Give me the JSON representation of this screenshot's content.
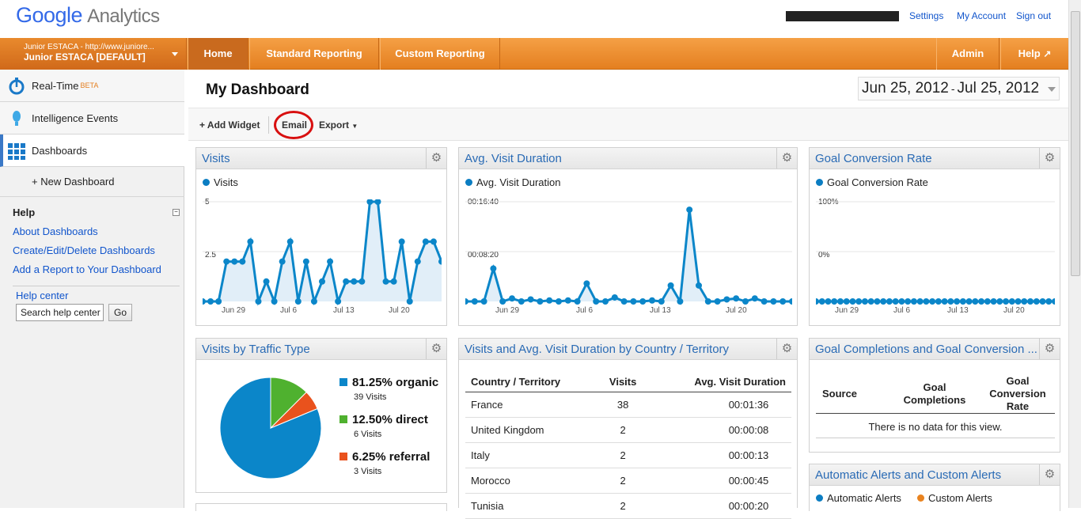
{
  "app": {
    "brand_google": "Google",
    "brand_analytics": "Analytics"
  },
  "toplinks": {
    "settings": "Settings",
    "account": "My Account",
    "signout": "Sign out"
  },
  "account": {
    "line1": "Junior ESTACA - http://www.juniore...",
    "line2": "Junior ESTACA [DEFAULT]"
  },
  "nav": {
    "home": "Home",
    "standard": "Standard Reporting",
    "custom": "Custom Reporting",
    "admin": "Admin",
    "help": "Help"
  },
  "sidebar": {
    "items": [
      {
        "label": "Real-Time",
        "badge": "BETA"
      },
      {
        "label": "Intelligence Events"
      },
      {
        "label": "Dashboards"
      }
    ],
    "new_dashboard": "+ New Dashboard",
    "help_title": "Help",
    "help_links": [
      "About Dashboards",
      "Create/Edit/Delete Dashboards",
      "Add a Report to Your Dashboard"
    ],
    "help_center": "Help center",
    "search_value": "Search help center",
    "go": "Go"
  },
  "dashboard": {
    "title": "My Dashboard",
    "date_start": "Jun 25, 2012",
    "date_sep": "-",
    "date_end": "Jul 25, 2012",
    "toolbar": {
      "add_widget": "+ Add Widget",
      "email": "Email",
      "export": "Export"
    }
  },
  "widgets": {
    "visits": {
      "title": "Visits",
      "legend": "Visits",
      "y_top": "5",
      "y_mid": "2.5"
    },
    "duration": {
      "title": "Avg. Visit Duration",
      "legend": "Avg. Visit Duration",
      "y_top": "00:16:40",
      "y_mid": "00:08:20"
    },
    "goal": {
      "title": "Goal Conversion Rate",
      "legend": "Goal Conversion Rate",
      "y_top": "100%",
      "y_bottom": "0%"
    },
    "x_ticks": [
      "Jun 29",
      "Jul 6",
      "Jul 13",
      "Jul 20"
    ],
    "traffic": {
      "title": "Visits by Traffic Type",
      "slices": [
        {
          "pct": "81.25% organic",
          "sub": "39 Visits",
          "color": "#0b86c9"
        },
        {
          "pct": "12.50% direct",
          "sub": "6 Visits",
          "color": "#4fb12f"
        },
        {
          "pct": "6.25% referral",
          "sub": "3 Visits",
          "color": "#e9521d"
        }
      ]
    },
    "country": {
      "title": "Visits and Avg. Visit Duration by Country / Territory",
      "headers": [
        "Country / Territory",
        "Visits",
        "Avg. Visit Duration"
      ],
      "rows": [
        [
          "France",
          "38",
          "00:01:36"
        ],
        [
          "United Kingdom",
          "2",
          "00:00:08"
        ],
        [
          "Italy",
          "2",
          "00:00:13"
        ],
        [
          "Morocco",
          "2",
          "00:00:45"
        ],
        [
          "Tunisia",
          "2",
          "00:00:20"
        ]
      ]
    },
    "goalcomp": {
      "title": "Goal Completions and Goal Conversion ...",
      "headers": [
        "Source",
        "Goal Completions",
        "Goal Conversion Rate"
      ],
      "empty": "There is no data for this view."
    },
    "alerts": {
      "title": "Automatic Alerts and Custom Alerts",
      "legend1": "Automatic Alerts",
      "legend2": "Custom Alerts"
    }
  },
  "chart_data": [
    {
      "type": "line",
      "title": "Visits",
      "series": [
        {
          "name": "Visits",
          "values": [
            0,
            0,
            0,
            2,
            2,
            2,
            3,
            0,
            1,
            0,
            2,
            3,
            0,
            2,
            0,
            1,
            2,
            0,
            1,
            1,
            1,
            5,
            5,
            1,
            1,
            3,
            0,
            2,
            3,
            3,
            2
          ]
        }
      ],
      "ylim": [
        0,
        5
      ]
    },
    {
      "type": "line",
      "title": "Avg. Visit Duration",
      "series": [
        {
          "name": "Avg. Visit Duration",
          "values": [
            0,
            0,
            0,
            330,
            0,
            30,
            0,
            20,
            0,
            10,
            0,
            10,
            0,
            180,
            0,
            0,
            40,
            0,
            0,
            0,
            10,
            0,
            160,
            0,
            920,
            160,
            0,
            0,
            20,
            30,
            0,
            30,
            0,
            0,
            0,
            0
          ]
        }
      ],
      "ylim": [
        0,
        1000
      ]
    },
    {
      "type": "line",
      "title": "Goal Conversion Rate",
      "series": [
        {
          "name": "Goal Conversion Rate",
          "values": [
            0,
            0,
            0,
            0,
            0,
            0,
            0,
            0,
            0,
            0,
            0,
            0,
            0,
            0,
            0,
            0,
            0,
            0,
            0,
            0,
            0,
            0,
            0,
            0,
            0,
            0,
            0,
            0,
            0,
            0,
            0,
            0,
            0,
            0,
            0,
            0,
            0,
            0,
            0,
            0
          ]
        }
      ],
      "ylim": [
        0,
        100
      ]
    },
    {
      "type": "pie",
      "title": "Visits by Traffic Type",
      "categories": [
        "organic",
        "direct",
        "referral"
      ],
      "values": [
        81.25,
        12.5,
        6.25
      ]
    }
  ]
}
